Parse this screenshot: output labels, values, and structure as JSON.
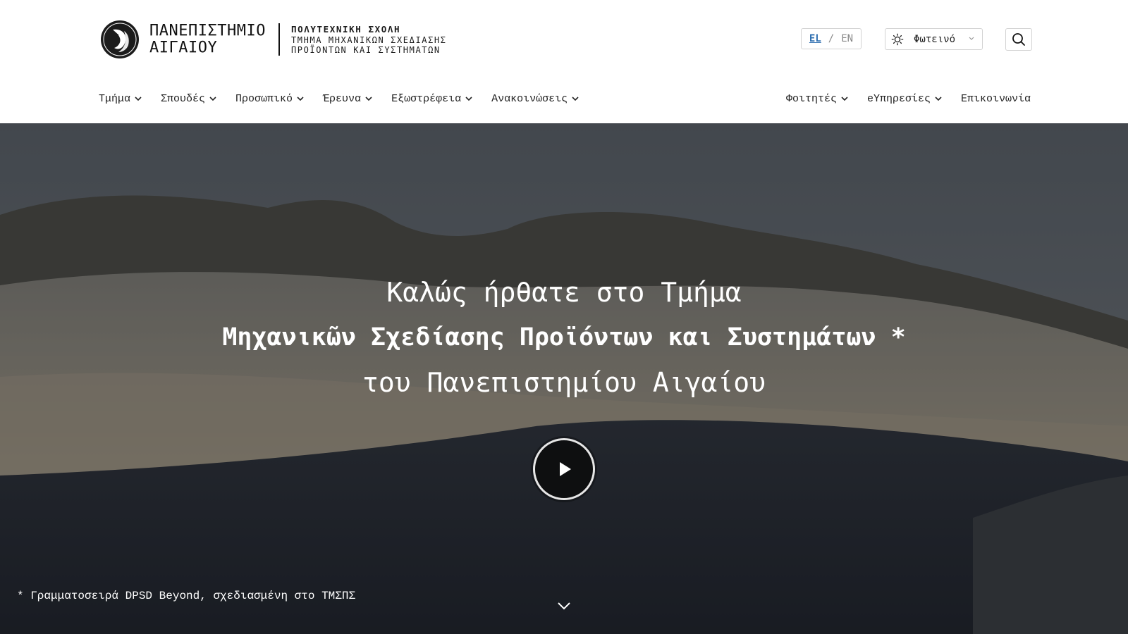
{
  "brand": {
    "university_line1": "ΠΑΝΕΠΙΣΤΗΜΙΟ",
    "university_line2": "ΑΙΓΑΙΟΥ",
    "school_title": "ΠΟΛΥΤΕΧΝΙΚΗ ΣΧΟΛΗ",
    "department_line1": "ΤΜΗΜΑ ΜΗΧΑΝΙΚΩΝ ΣΧΕΔΙΑΣΗΣ",
    "department_line2": "ΠΡΟΪΟΝΤΩΝ ΚΑΙ ΣΥΣΤΗΜΑΤΩΝ"
  },
  "header": {
    "lang_el": "EL",
    "lang_sep": "/",
    "lang_en": "EN",
    "theme_label": "Φωτεινό",
    "icons": {
      "theme": "sun-icon",
      "search": "search-icon",
      "dropdown": "chevron-down-icon"
    }
  },
  "nav": {
    "left": [
      {
        "label": "Τμήμα",
        "has_dropdown": true
      },
      {
        "label": "Σπουδές",
        "has_dropdown": true
      },
      {
        "label": "Προσωπικό",
        "has_dropdown": true
      },
      {
        "label": "Έρευνα",
        "has_dropdown": true
      },
      {
        "label": "Εξωστρέφεια",
        "has_dropdown": true
      },
      {
        "label": "Ανακοινώσεις",
        "has_dropdown": true
      }
    ],
    "right": [
      {
        "label": "Φοιτητές",
        "has_dropdown": true
      },
      {
        "label": "eΥπηρεσίες",
        "has_dropdown": true
      },
      {
        "label": "Επικοινωνία",
        "has_dropdown": false
      }
    ]
  },
  "hero": {
    "line1": "Καλώς ήρθατε στο Τμήμα",
    "line2": "Μηχανικῶν Σχεδίασης Προϊόντων και Συστημάτων *",
    "line3": "του Πανεπιστημίου Αιγαίου",
    "footnote": "* Γραμματοσειρά DPSD Beyond, σχεδιασμένη στο ΤΜΣΠΣ",
    "icons": {
      "play": "play-icon",
      "scroll": "chevron-down-icon"
    }
  },
  "colors": {
    "accent": "#2f6fb0",
    "text": "#1a1a1a",
    "border": "#d3d3d3"
  }
}
